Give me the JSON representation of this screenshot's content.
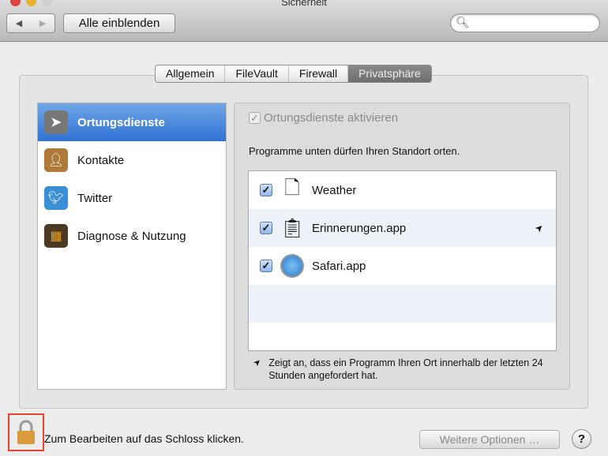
{
  "window": {
    "title": "Sicherheit"
  },
  "toolbar": {
    "show_all": "Alle einblenden",
    "search_placeholder": ""
  },
  "tabs": [
    {
      "label": "Allgemein"
    },
    {
      "label": "FileVault"
    },
    {
      "label": "Firewall"
    },
    {
      "label": "Privatsphäre",
      "selected": true
    }
  ],
  "sidebar": {
    "items": [
      {
        "label": "Ortungsdienste",
        "icon": "location-arrow-icon",
        "selected": true
      },
      {
        "label": "Kontakte",
        "icon": "contacts-book-icon"
      },
      {
        "label": "Twitter",
        "icon": "twitter-bird-icon"
      },
      {
        "label": "Diagnose & Nutzung",
        "icon": "diagnostics-icon"
      }
    ]
  },
  "location": {
    "enable_label": "Ortungsdienste aktivieren",
    "enabled": true,
    "description": "Programme unten dürfen Ihren Standort orten.",
    "apps": [
      {
        "name": "Weather",
        "checked": true,
        "icon": "document-icon"
      },
      {
        "name": "Erinnerungen.app",
        "checked": true,
        "icon": "reminders-icon",
        "recent": true
      },
      {
        "name": "Safari.app",
        "checked": true,
        "icon": "safari-compass-icon"
      }
    ],
    "note": "Zeigt an, dass ein Programm Ihren Ort innerhalb der letzten 24 Stunden angefordert hat."
  },
  "footer": {
    "lock_text": "Zum Bearbeiten auf das Schloss klicken.",
    "more_options": "Weitere Optionen …",
    "help": "?"
  },
  "colors": {
    "selection": "#2f72d4",
    "lock_highlight": "#e8452c"
  }
}
